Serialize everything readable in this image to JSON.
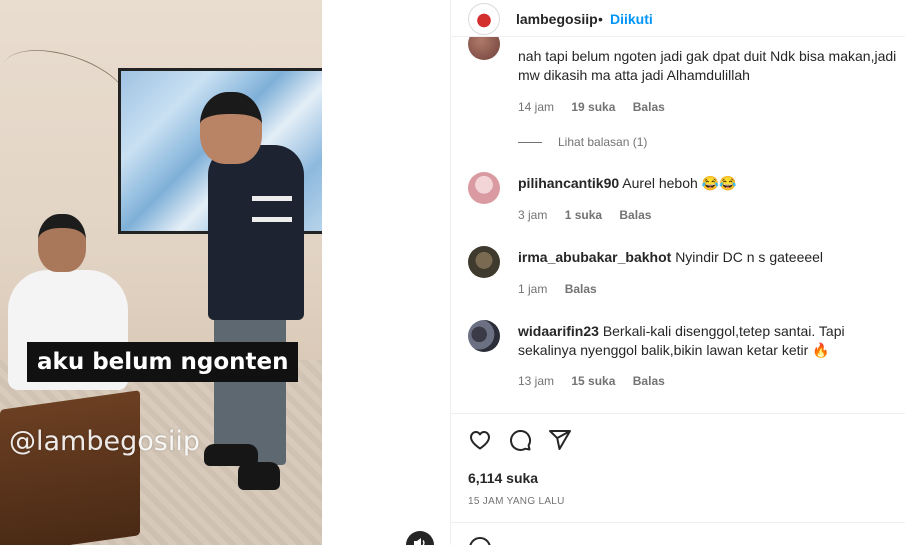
{
  "video": {
    "caption": "aku belum ngonten",
    "watermark": "@lambegosiip"
  },
  "header": {
    "username": "lambegosiip",
    "separator": "•",
    "follow_label": "Diikuti"
  },
  "comments": [
    {
      "username": "",
      "text": "nah tapi belum ngoten jadi gak dpat duit Ndk bisa makan,jadi mw dikasih ma atta jadi Alhamdulillah",
      "time": "14 jam",
      "likes": "19 suka",
      "reply": "Balas",
      "view_replies": "Lihat balasan (1)"
    },
    {
      "username": "pilihancantik90",
      "text": "Aurel heboh 😂😂",
      "time": "3 jam",
      "likes": "1 suka",
      "reply": "Balas"
    },
    {
      "username": "irma_abubakar_bakhot",
      "text": "Nyindir DC n s gateeeel",
      "time": "1 jam",
      "reply": "Balas"
    },
    {
      "username": "widaarifin23",
      "text": "Berkali-kali disenggol,tetep santai. Tapi sekalinya nyenggol balik,bikin lawan ketar ketir 🔥",
      "time": "13 jam",
      "likes": "15 suka",
      "reply": "Balas"
    }
  ],
  "footer": {
    "likes": "6,114 suka",
    "posted": "15 JAM YANG LALU"
  },
  "icons": [
    "heart-icon",
    "comment-icon",
    "share-icon",
    "volume-icon",
    "emoji-icon"
  ]
}
